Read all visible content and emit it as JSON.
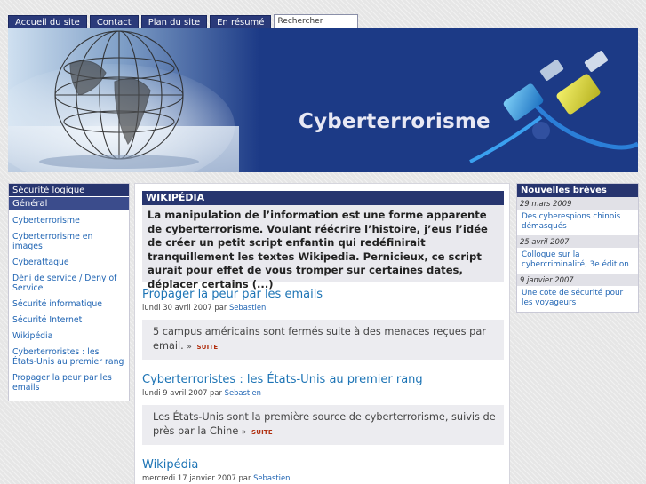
{
  "nav": {
    "tabs": [
      {
        "label": "Accueil du site"
      },
      {
        "label": "Contact"
      },
      {
        "label": "Plan du site"
      },
      {
        "label": "En résumé"
      }
    ],
    "search_value": "Rechercher"
  },
  "banner": {
    "title": "Cyberterrorisme"
  },
  "sidebar": {
    "heading": "Sécurité logique",
    "selected": "Général",
    "items": [
      {
        "label": "Cyberterrorisme"
      },
      {
        "label": "Cyberterrorisme en images"
      },
      {
        "label": "Cyberattaque"
      },
      {
        "label": "Déni de service / Deny of Service"
      },
      {
        "label": "Sécurité informatique"
      },
      {
        "label": "Sécurité Internet"
      },
      {
        "label": "Wikipédia"
      },
      {
        "label": "Cyberterroristes : les États-Unis au premier rang"
      },
      {
        "label": "Propager la peur par les emails"
      }
    ]
  },
  "main": {
    "feature": {
      "heading": "WIKIPÉDIA",
      "text": "La manipulation de l’information est une forme apparente de cyberterrorisme. Voulant réécrire l’histoire, j’eus l’idée de créer un petit script enfantin qui redéfinirait tranquillement les textes Wikipedia. Pernicieux, ce script aurait pour effet de vous tromper sur certaines dates, déplacer certains (...)"
    },
    "articles": [
      {
        "title": "Propager la peur par les emails",
        "meta": "lundi 30 avril 2007 par ",
        "author": "Sebastien",
        "summary": "5 campus américains sont fermés suite à des menaces reçues par email.",
        "more": "SUITE"
      },
      {
        "title": "Cyberterroristes : les États-Unis au premier rang",
        "meta": "lundi 9 avril 2007 par ",
        "author": "Sebastien",
        "summary": "Les États-Unis sont la première source de cyberterrorisme, suivis de près par la Chine",
        "more": "SUITE"
      },
      {
        "title": "Wikipédia",
        "meta": "mercredi 17 janvier 2007 par ",
        "author": "Sebastien"
      }
    ]
  },
  "news": {
    "heading": "Nouvelles brèves",
    "items": [
      {
        "date": "29 mars 2009",
        "title": "Des cyberespions chinois démasqués"
      },
      {
        "date": "25 avril 2007",
        "title": "Colloque sur la cybercriminalité, 3e édition"
      },
      {
        "date": "9 janvier 2007",
        "title": "Une cote de sécurité pour les voyageurs"
      }
    ]
  },
  "colors": {
    "nav_bg": "#2a3a7a",
    "heading_bg": "#27356f",
    "link": "#1f64b3",
    "title_link": "#1d74b5",
    "more_link": "#b03010"
  },
  "icons": [
    "arrow-right-icon",
    "globe-graphic",
    "network-cables-graphic"
  ]
}
